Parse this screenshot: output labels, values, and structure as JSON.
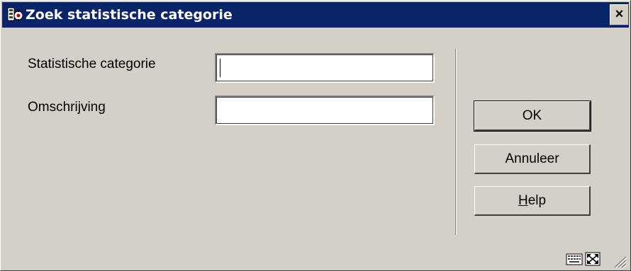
{
  "window": {
    "title": "Zoek statistische categorie",
    "close_label": "×"
  },
  "form": {
    "category_label": "Statistische categorie",
    "category_value": "",
    "description_label": "Omschrijving",
    "description_value": ""
  },
  "buttons": {
    "ok": "OK",
    "cancel": "Annuleer",
    "help_mnemonic": "H",
    "help_rest": "elp"
  },
  "icons": {
    "app": "app-icon",
    "keyboard": "keyboard-icon",
    "maximize": "maximize-icon",
    "resize": "resize-grip-icon"
  },
  "colors": {
    "titlebar": "#0a246a",
    "dialog": "#d4d0c8"
  }
}
